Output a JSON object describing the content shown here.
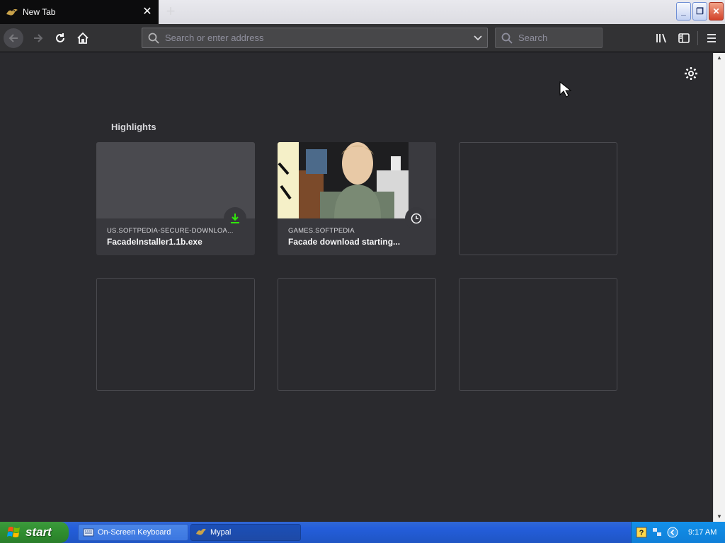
{
  "tab": {
    "title": "New Tab"
  },
  "urlbar": {
    "placeholder": "Search or enter address"
  },
  "searchbar": {
    "placeholder": "Search"
  },
  "highlights": {
    "title": "Highlights",
    "cards": [
      {
        "host": "US.SOFTPEDIA-SECURE-DOWNLOA...",
        "title": "FacadeInstaller1.1b.exe",
        "badge": "download-icon"
      },
      {
        "host": "GAMES.SOFTPEDIA",
        "title": "Facade download starting...",
        "badge": "clock-icon"
      }
    ]
  },
  "taskbar": {
    "start_label": "start",
    "tasks": [
      {
        "label": "On-Screen Keyboard"
      },
      {
        "label": "Mypal"
      }
    ],
    "clock": "9:17 AM"
  },
  "colors": {
    "content_bg": "#2a2a2e",
    "card_bg": "#38383d",
    "download_green": "#30e60b",
    "taskbar_blue": "#245edb",
    "start_green": "#3c9a3c"
  }
}
